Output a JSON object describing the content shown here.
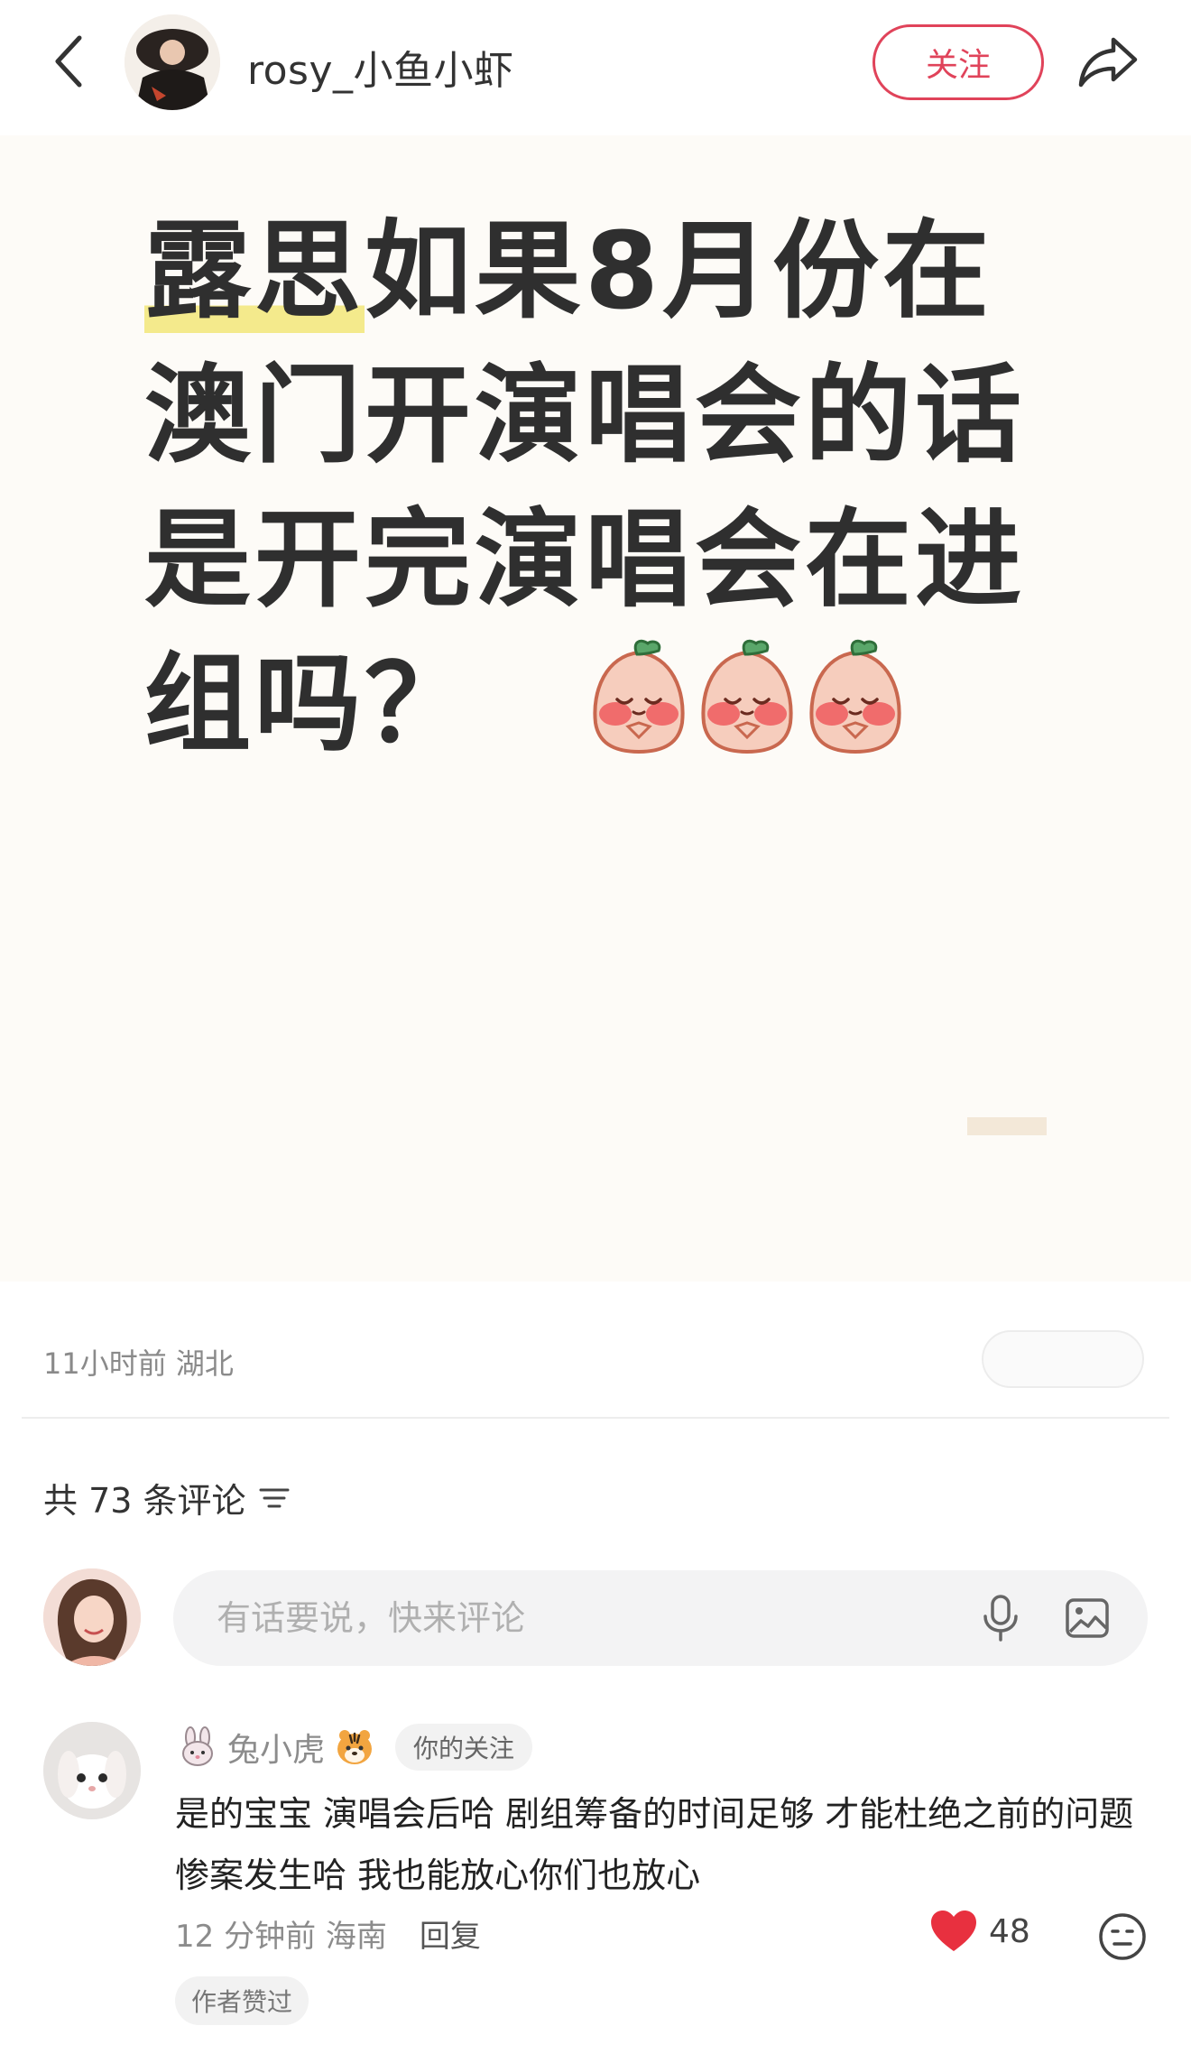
{
  "header": {
    "author_name": "rosy_小鱼小虾",
    "follow_label": "关注"
  },
  "note": {
    "title_highlight": "露思",
    "title_rest": "如果8月份在澳门开演唱会的话是开完演唱会在进组吗？"
  },
  "meta": {
    "time_location": "11小时前 湖北"
  },
  "comments": {
    "count_label": "共 73 条评论",
    "input_placeholder": "有话要说，快来评论",
    "items": [
      {
        "username": "兔小虎",
        "tag": "你的关注",
        "text": "是的宝宝 演唱会后哈 剧组筹备的时间足够 才能杜绝之前的问题惨案发生哈 我也能放心你们也放心",
        "time_location": "12 分钟前 海南",
        "reply_label": "回复",
        "likes": "48",
        "badge": "作者赞过"
      }
    ]
  },
  "colors": {
    "accent": "#e0435a",
    "highlight": "#f4ea8c",
    "card_bg": "#fdfbf7"
  }
}
